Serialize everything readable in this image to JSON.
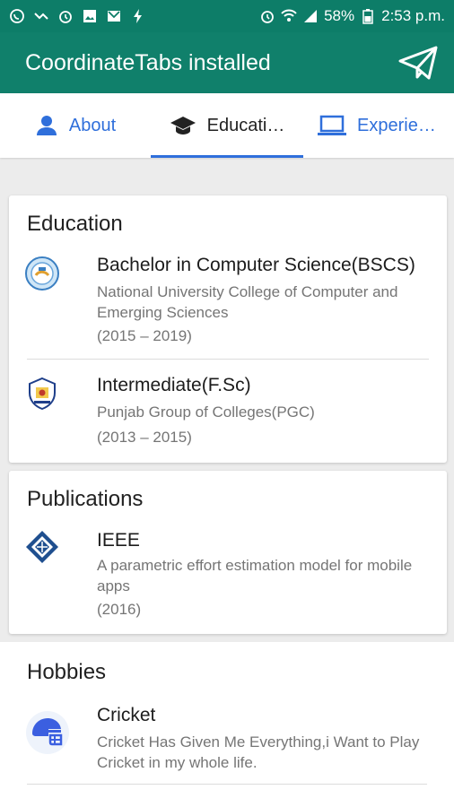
{
  "status_bar": {
    "battery": "58%",
    "time": "2:53 p.m."
  },
  "app_bar": {
    "title": "CoordinateTabs installed"
  },
  "tabs": [
    {
      "label": "About",
      "icon": "person-icon"
    },
    {
      "label": "Educati…",
      "icon": "graduation-cap-icon"
    },
    {
      "label": "Experie…",
      "icon": "laptop-icon"
    }
  ],
  "education": {
    "title": "Education",
    "items": [
      {
        "title": "Bachelor in Computer Science(BSCS)",
        "institution": "National University College of Computer and Emerging Sciences",
        "years": "(2015 – 2019)"
      },
      {
        "title": "Intermediate(F.Sc)",
        "institution": "Punjab Group of Colleges(PGC)",
        "years": "(2013 – 2015)"
      }
    ]
  },
  "publications": {
    "title": "Publications",
    "items": [
      {
        "title": "IEEE",
        "description": "A parametric effort estimation model for mobile apps",
        "year": "(2016)"
      }
    ]
  },
  "hobbies": {
    "title": "Hobbies",
    "items": [
      {
        "title": "Cricket",
        "description": "Cricket Has Given Me Everything,i Want to Play Cricket in my whole life."
      }
    ]
  },
  "colors": {
    "app_bar": "#10806b",
    "status_bar": "#0d7d68",
    "accent": "#2f6fdb"
  }
}
